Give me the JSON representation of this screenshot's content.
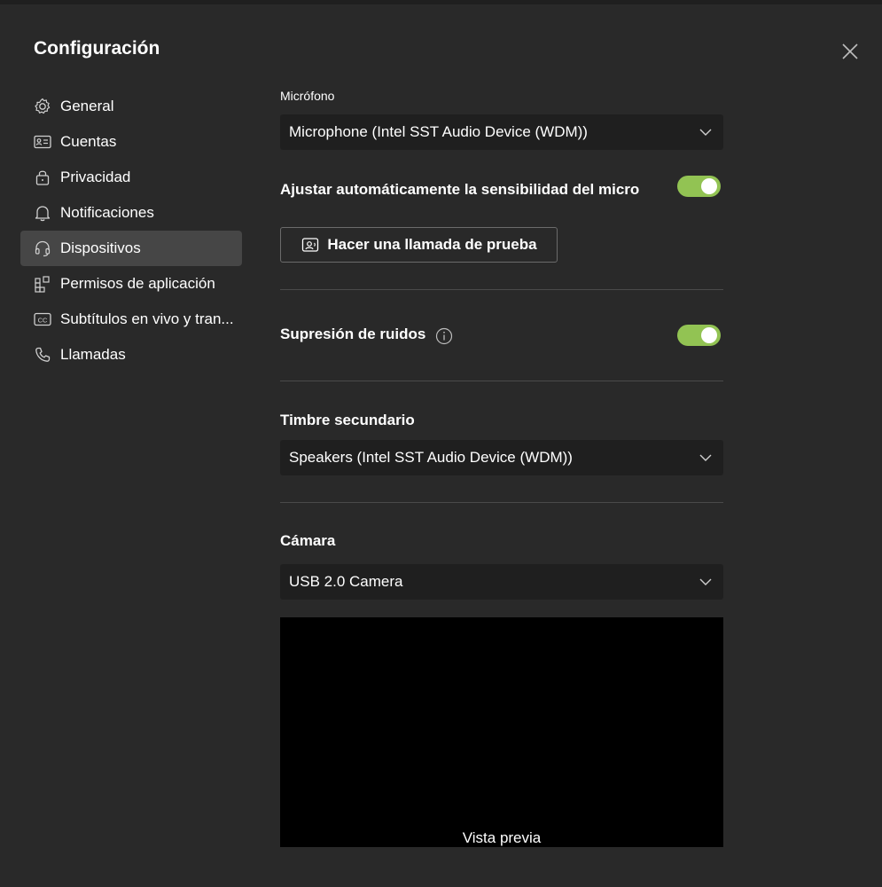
{
  "title": "Configuración",
  "nav": {
    "items": [
      {
        "label": "General",
        "icon": "gear-icon"
      },
      {
        "label": "Cuentas",
        "icon": "id-card-icon"
      },
      {
        "label": "Privacidad",
        "icon": "lock-icon"
      },
      {
        "label": "Notificaciones",
        "icon": "bell-icon"
      },
      {
        "label": "Dispositivos",
        "icon": "headset-icon"
      },
      {
        "label": "Permisos de aplicación",
        "icon": "apps-icon"
      },
      {
        "label": "Subtítulos en vivo y tran...",
        "icon": "closed-caption-icon"
      },
      {
        "label": "Llamadas",
        "icon": "phone-icon"
      }
    ],
    "active": "Dispositivos"
  },
  "microphone": {
    "label": "Micrófono",
    "value": "Microphone (Intel SST Audio Device (WDM))"
  },
  "auto_sensitivity": {
    "label": "Ajustar automáticamente la sensibilidad del micro",
    "on": true
  },
  "test_call_button": "Hacer una llamada de prueba",
  "noise_suppression": {
    "label": "Supresión de ruidos",
    "on": true
  },
  "secondary_ringer": {
    "label": "Timbre secundario",
    "value": "Speakers (Intel SST Audio Device (WDM))"
  },
  "camera": {
    "label": "Cámara",
    "value": "USB 2.0 Camera",
    "preview_label": "Vista previa"
  },
  "colors": {
    "background": "#292929",
    "select_bg": "#1f1f1f",
    "toggle_on": "#92c353",
    "active_nav": "#464646"
  }
}
